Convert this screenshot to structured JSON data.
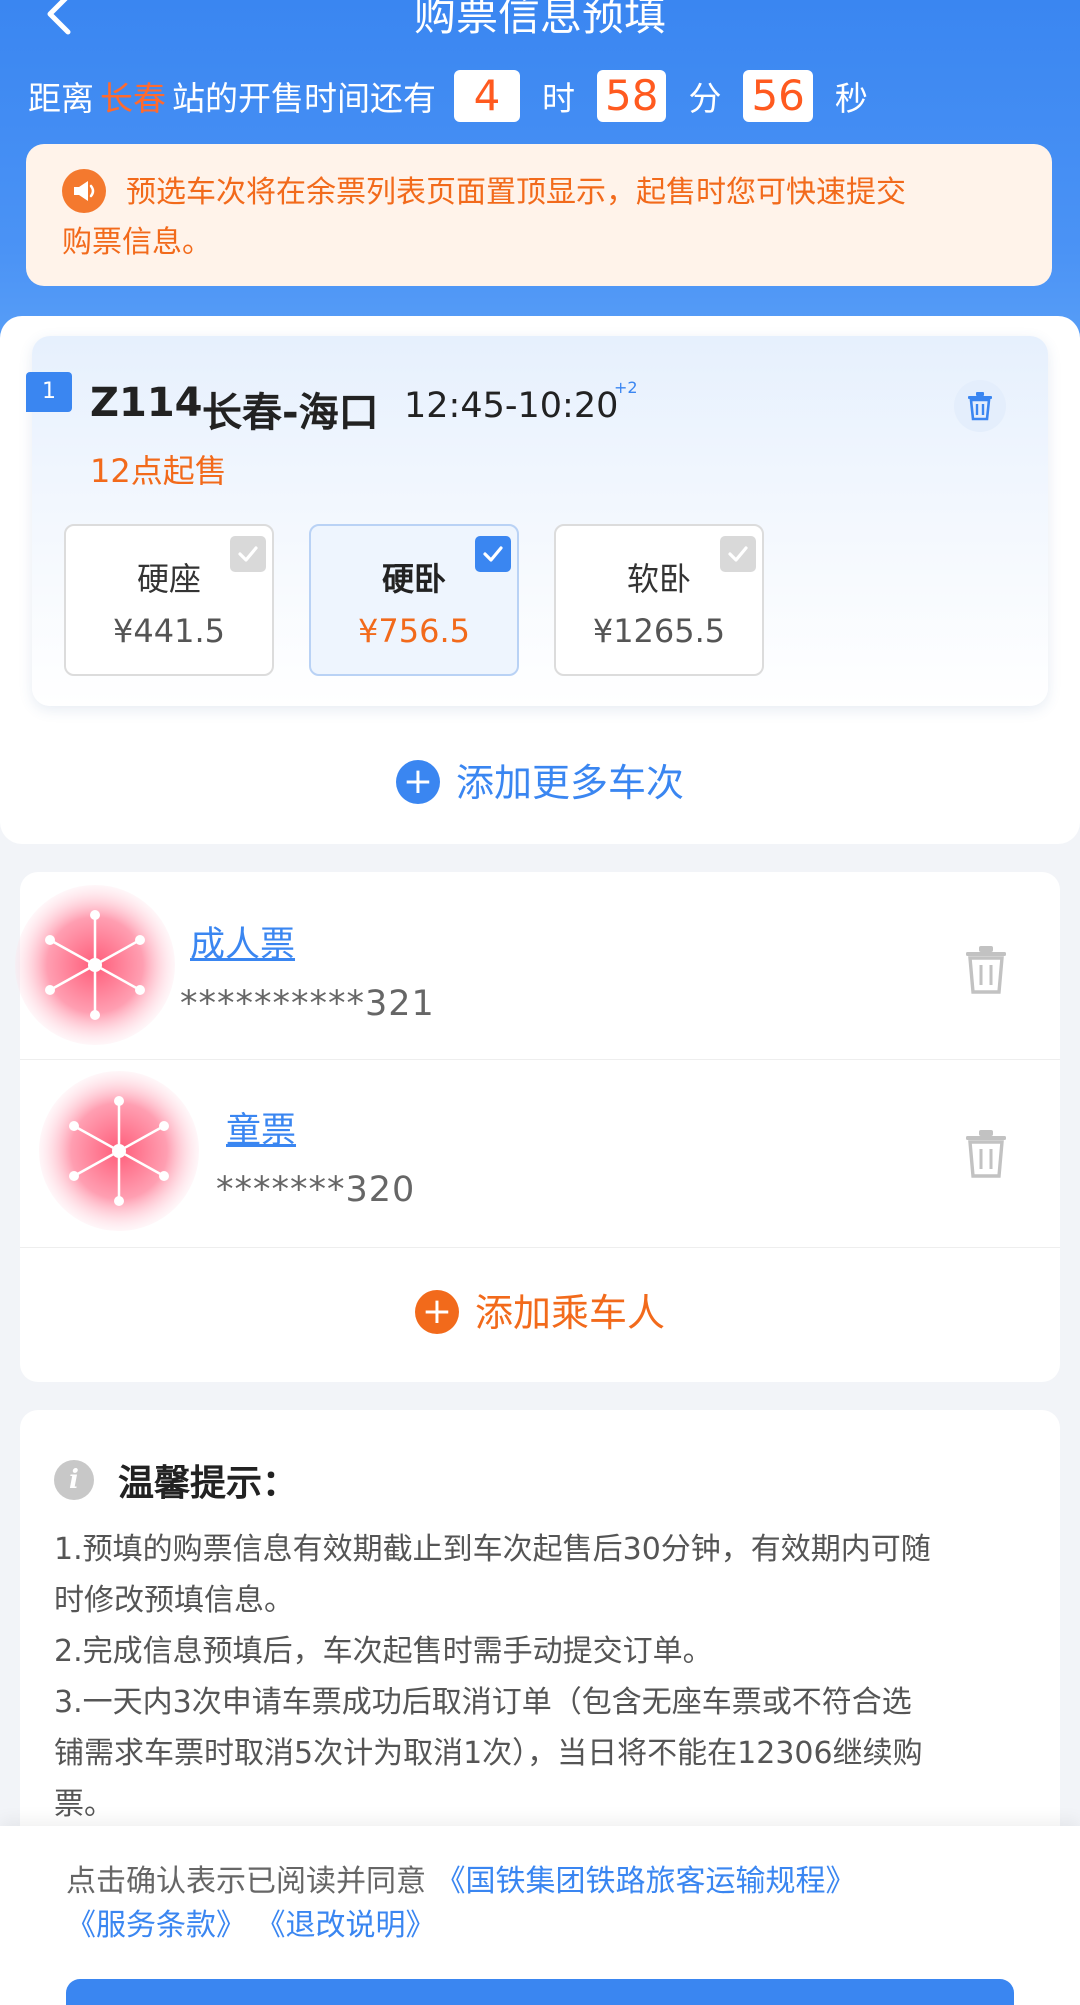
{
  "header": {
    "title": "购票信息预填",
    "countdown": {
      "prefix": "距离",
      "station": "长春",
      "suffix": "站的开售时间还有",
      "hours": "4",
      "hour_unit": "时",
      "minutes": "58",
      "minute_unit": "分",
      "seconds": "56",
      "second_unit": "秒"
    }
  },
  "notice": {
    "line1": "预选车次将在余票列表页面置顶显示，起售时您可快速提交",
    "line2": "购票信息。"
  },
  "train": {
    "seq": "1",
    "number": "Z114",
    "route": "长春-海口",
    "time": "12:45-10:20",
    "day_offset": "+2",
    "sale_time": "12点起售",
    "seats": [
      {
        "name": "硬座",
        "price": "¥441.5",
        "selected": false
      },
      {
        "name": "硬卧",
        "price": "¥756.5",
        "selected": true
      },
      {
        "name": "软卧",
        "price": "¥1265.5",
        "selected": false
      }
    ],
    "add_more": "添加更多车次"
  },
  "passengers": {
    "items": [
      {
        "ticket_type": "成人票",
        "id_masked": "**********321"
      },
      {
        "ticket_type": "童票",
        "id_masked": "*******320"
      }
    ],
    "add_label": "添加乘车人"
  },
  "tips": {
    "title": "温馨提示：",
    "lines": [
      "1.预填的购票信息有效期截止到车次起售后30分钟，有效期内可随",
      "时修改预填信息。",
      "2.完成信息预填后，车次起售时需手动提交订单。",
      "3.一天内3次申请车票成功后取消订单（包含无座车票或不符合选",
      "铺需求车票时取消5次计为取消1次），当日将不能在12306继续购",
      "票。"
    ]
  },
  "agreement": {
    "text": "点击确认表示已阅读并同意",
    "link_rules": "《国铁集团铁路旅客运输规程》",
    "link_terms": "《服务条款》",
    "link_refund": "《退改说明》"
  },
  "colors": {
    "primary": "#3a86f1",
    "accent": "#f26a1b"
  }
}
